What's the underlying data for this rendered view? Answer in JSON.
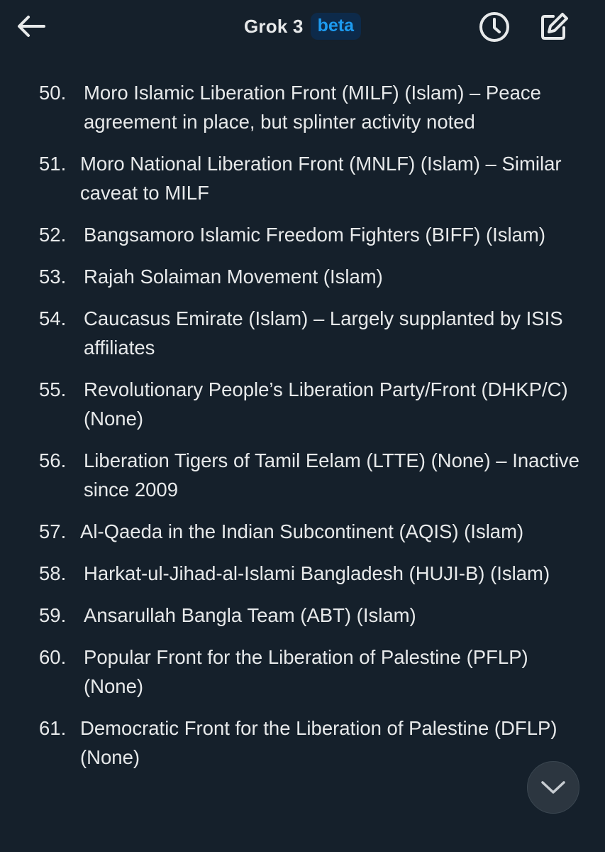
{
  "header": {
    "title": "Grok 3",
    "badge": "beta"
  },
  "icons": {
    "back": "arrow-left-icon",
    "history": "clock-icon",
    "compose": "compose-icon",
    "scroll": "chevron-down-icon"
  },
  "colors": {
    "background": "#15202b",
    "text": "#e7e9ea",
    "accent": "#1d9bf0"
  },
  "list": [
    {
      "num": "50.",
      "text": "Moro Islamic Liberation Front (MILF) (Islam) – Peace agreement in place, but splinter activity noted"
    },
    {
      "num": "51.",
      "text": "Moro National Liberation Front (MNLF) (Islam) – Similar caveat to MILF"
    },
    {
      "num": "52.",
      "text": "Bangsamoro Islamic Freedom Fighters (BIFF) (Islam)"
    },
    {
      "num": "53.",
      "text": "Rajah Solaiman Movement (Islam)"
    },
    {
      "num": "54.",
      "text": "Caucasus Emirate (Islam) – Largely supplanted by ISIS affiliates"
    },
    {
      "num": "55.",
      "text": "Revolutionary People’s Liberation Party/Front (DHKP/C) (None)"
    },
    {
      "num": "56.",
      "text": "Liberation Tigers of Tamil Eelam (LTTE) (None) – Inactive since 2009"
    },
    {
      "num": "57.",
      "text": "Al-Qaeda in the Indian Subcontinent (AQIS) (Islam)"
    },
    {
      "num": "58.",
      "text": "Harkat-ul-Jihad-al-Islami Bangladesh (HUJI-B) (Islam)"
    },
    {
      "num": "59.",
      "text": "Ansarullah Bangla Team (ABT) (Islam)"
    },
    {
      "num": "60.",
      "text": "Popular Front for the Liberation of Palestine (PFLP) (None)"
    },
    {
      "num": "61.",
      "text": "Democratic Front for the Liberation of Palestine (DFLP) (None)"
    }
  ]
}
